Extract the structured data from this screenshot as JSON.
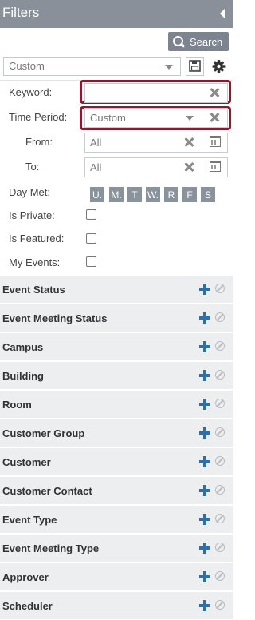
{
  "header": {
    "title": "Filters"
  },
  "search": {
    "button_label": "Search"
  },
  "saved_filter": {
    "value": "Custom"
  },
  "keyword": {
    "label": "Keyword:",
    "value": ""
  },
  "time_period": {
    "label": "Time Period:",
    "value": "Custom"
  },
  "from": {
    "label": "From:",
    "value": "All"
  },
  "to": {
    "label": "To:",
    "value": "All"
  },
  "day_met": {
    "label": "Day Met:",
    "days": [
      "U.",
      "M.",
      "T",
      "W.",
      "R",
      "F",
      "S"
    ]
  },
  "is_private": {
    "label": "Is Private:"
  },
  "is_featured": {
    "label": "Is Featured:"
  },
  "my_events": {
    "label": "My Events:"
  },
  "sections": [
    "Event Status",
    "Event Meeting Status",
    "Campus",
    "Building",
    "Room",
    "Customer Group",
    "Customer",
    "Customer Contact",
    "Event Type",
    "Event Meeting Type",
    "Approver",
    "Scheduler"
  ],
  "colors": {
    "header_bg": "#8a9099",
    "highlight": "#8b1a2e",
    "plus": "#2f6fa9",
    "section_bg": "#eceef0"
  }
}
